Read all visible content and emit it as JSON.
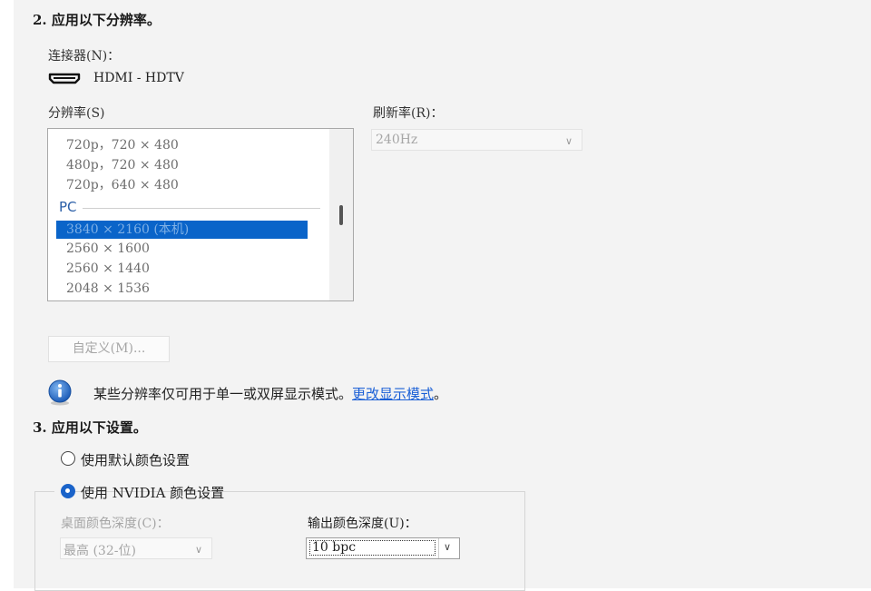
{
  "step2": {
    "heading": "2. 应用以下分辨率。",
    "connector_label": "连接器(N)：",
    "connector_value": "HDMI - HDTV",
    "connector_icon": "hdmi-connector-icon",
    "resolution_label": "分辨率(S)",
    "refresh_label": "刷新率(R)：",
    "refresh_value": "240Hz",
    "resolution_list": {
      "items_top": [
        "720p，720 × 480",
        "480p，720 × 480",
        "720p，640 × 480"
      ],
      "group_label": "PC",
      "selected": "3840 × 2160 (本机)",
      "items_bottom": [
        "2560 × 1600",
        "2560 × 1440",
        "2048 × 1536"
      ]
    },
    "custom_button": "自定义(M)...",
    "info_text": "某些分辨率仅可用于单一或双屏显示模式。",
    "info_link": "更改显示模式",
    "info_end": "。"
  },
  "step3": {
    "heading": "3. 应用以下设置。",
    "radio_default": "使用默认颜色设置",
    "radio_nvidia": "使用 NVIDIA 颜色设置",
    "desktop_depth_label": "桌面颜色深度(C)：",
    "desktop_depth_value": "最高 (32-位)",
    "output_depth_label": "输出颜色深度(U)：",
    "output_depth_value": "10 bpc"
  },
  "colors": {
    "accent": "#0a64c9",
    "link": "#1a5fd6",
    "panel_bg": "#f3f3f3"
  }
}
